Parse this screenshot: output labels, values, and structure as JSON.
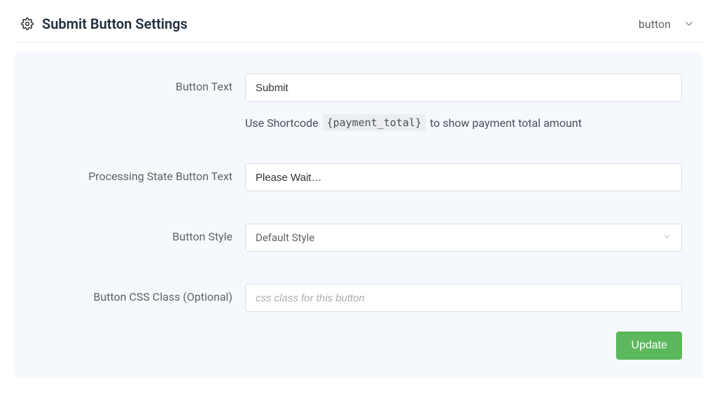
{
  "header": {
    "title": "Submit Button Settings",
    "type_label": "button"
  },
  "form": {
    "button_text": {
      "label": "Button Text",
      "value": "Submit",
      "help_prefix": "Use Shortcode",
      "help_shortcode": "{payment_total}",
      "help_suffix": "to show payment total amount"
    },
    "processing_text": {
      "label": "Processing State Button Text",
      "value": "Please Wait…"
    },
    "button_style": {
      "label": "Button Style",
      "selected": "Default Style"
    },
    "css_class": {
      "label": "Button CSS Class (Optional)",
      "value": "",
      "placeholder": "css class for this button"
    }
  },
  "actions": {
    "update_label": "Update"
  }
}
